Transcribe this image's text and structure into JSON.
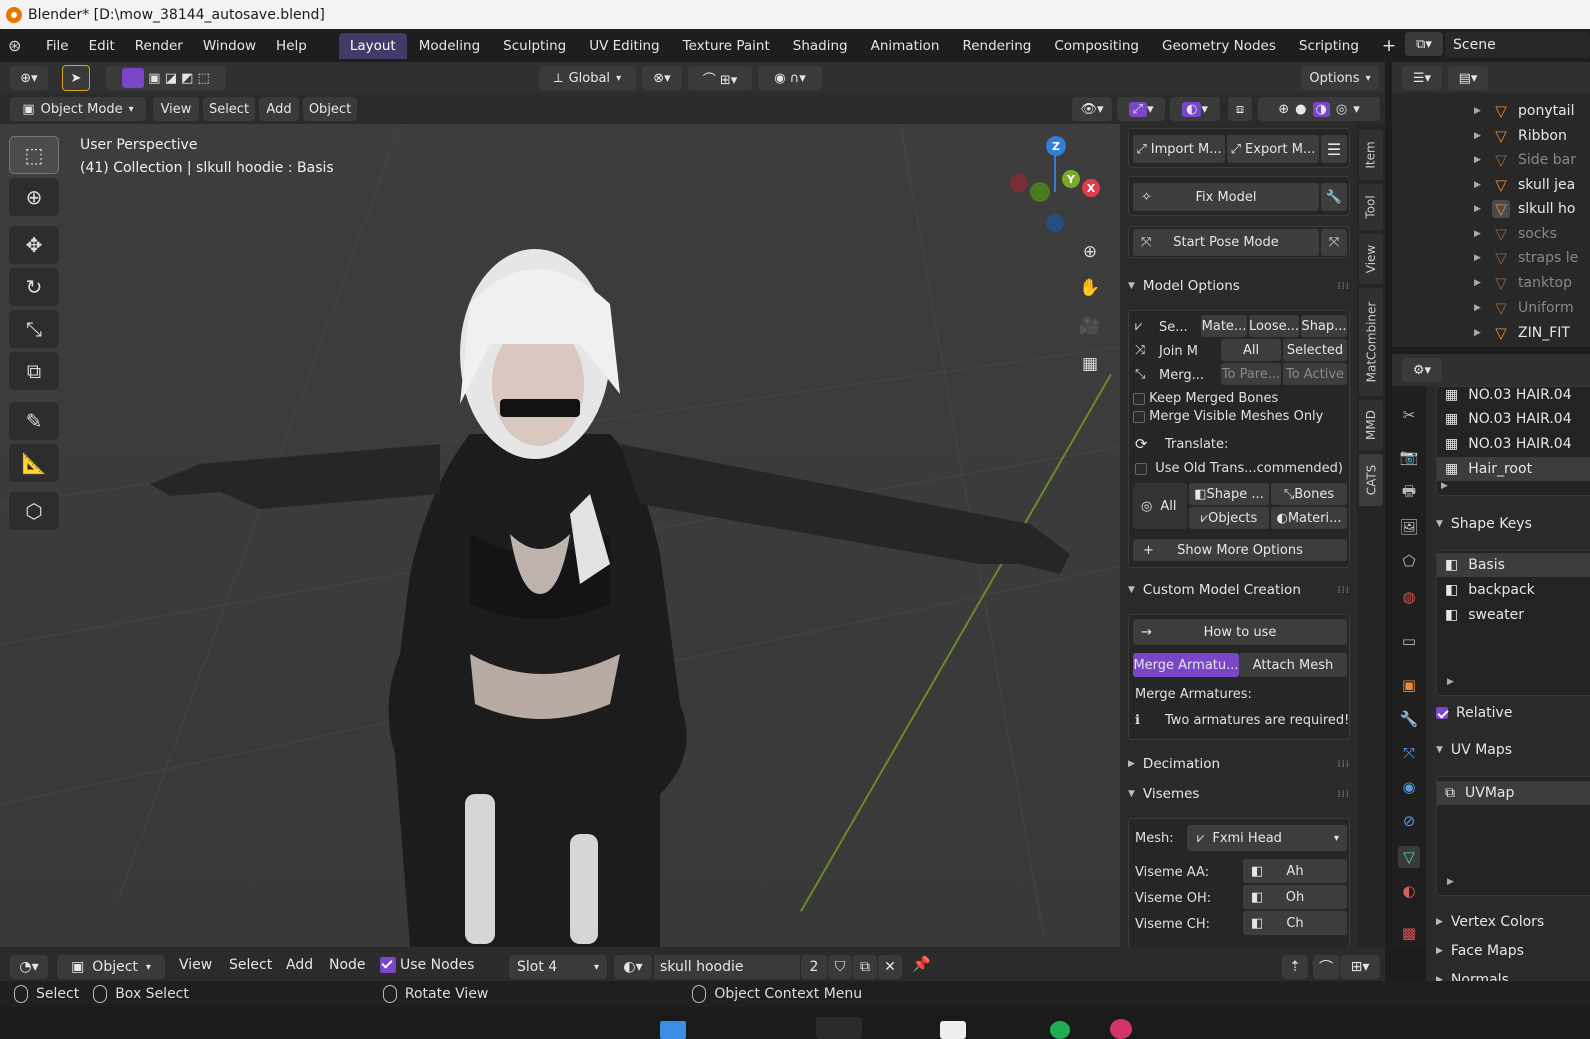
{
  "window": {
    "title": "Blender* [D:\\mow_38144_autosave.blend]"
  },
  "menu": [
    "File",
    "Edit",
    "Render",
    "Window",
    "Help"
  ],
  "workspaces": [
    "Layout",
    "Modeling",
    "Sculpting",
    "UV Editing",
    "Texture Paint",
    "Shading",
    "Animation",
    "Rendering",
    "Compositing",
    "Geometry Nodes",
    "Scripting"
  ],
  "add_workspace": "+",
  "scene": {
    "name": "Scene"
  },
  "header": {
    "orientation": "Global",
    "options": "Options"
  },
  "header2": {
    "mode": "Object Mode",
    "menu": [
      "View",
      "Select",
      "Add",
      "Object"
    ]
  },
  "viewport": {
    "perspective": "User Perspective",
    "collection_info": "(41) Collection | slkull hoodie : Basis",
    "axes": {
      "z": "Z",
      "y": "Y",
      "x": "X"
    }
  },
  "npanel": {
    "import": "Import M...",
    "export": "Export M...",
    "fix_model": "Fix Model",
    "start_pose": "Start Pose Mode",
    "model_options": {
      "title": "Model Options",
      "separate": "Se...",
      "sep_opts": [
        "Mate...",
        "Loose...",
        "Shap..."
      ],
      "join": "Join M",
      "join_opts": [
        "All",
        "Selected"
      ],
      "merge": "Merg...",
      "merge_opts": [
        "To Pare...",
        "To Active"
      ],
      "keep_merged": "Keep Merged Bones",
      "merge_visible": "Merge Visible Meshes Only",
      "translate": "Translate:",
      "use_old": "Use Old Trans...commended)",
      "all": "All",
      "tr_opts": [
        "Shape ...",
        "Bones",
        "Objects",
        "Materi..."
      ],
      "show_more": "Show More Options"
    },
    "custom_model": {
      "title": "Custom Model Creation",
      "how_to": "How to use",
      "tabs": [
        "Merge Armatu...",
        "Attach Mesh"
      ],
      "merge_label": "Merge Armatures:",
      "warning": "Two armatures are required!"
    },
    "decimation": "Decimation",
    "visemes": {
      "title": "Visemes",
      "mesh_label": "Mesh:",
      "mesh_value": "Fxmi Head",
      "rows": [
        {
          "label": "Viseme AA:",
          "value": "Ah"
        },
        {
          "label": "Viseme OH:",
          "value": "Oh"
        },
        {
          "label": "Viseme CH:",
          "value": "Ch"
        }
      ]
    }
  },
  "vtabs": [
    "Item",
    "Tool",
    "View",
    "MatCombiner",
    "MMD",
    "CATS"
  ],
  "outliner": {
    "items": [
      {
        "name": "ponytail",
        "dim": false
      },
      {
        "name": "Ribbon",
        "dim": false
      },
      {
        "name": "Side bar",
        "dim": true
      },
      {
        "name": "skull jea",
        "dim": false
      },
      {
        "name": "slkull ho",
        "dim": false
      },
      {
        "name": "socks",
        "dim": true
      },
      {
        "name": "straps le",
        "dim": true
      },
      {
        "name": "tanktop",
        "dim": true
      },
      {
        "name": "Uniform",
        "dim": true
      },
      {
        "name": "ZIN_FIT",
        "dim": false
      }
    ]
  },
  "properties": {
    "vgroups": [
      "NO.03 HAIR.04",
      "NO.03 HAIR.04",
      "NO.03 HAIR.04",
      "Hair_root"
    ],
    "shape_keys_title": "Shape Keys",
    "shape_keys": [
      "Basis",
      "backpack",
      "sweater"
    ],
    "relative": "Relative",
    "uv_maps_title": "UV Maps",
    "uv_maps": [
      "UVMap"
    ],
    "vertex_colors": "Vertex Colors",
    "face_maps": "Face Maps",
    "normals": "Normals"
  },
  "bottom": {
    "editor": "Object",
    "menu": [
      "View",
      "Select",
      "Add",
      "Node"
    ],
    "use_nodes": "Use Nodes",
    "slot": "Slot 4",
    "material": "skull hoodie",
    "users": "2"
  },
  "status": {
    "select": "Select",
    "box_select": "Box Select",
    "rotate": "Rotate View",
    "context": "Object Context Menu"
  },
  "colors": {
    "accent": "#7a46c8",
    "workspace_active": "#443a6a",
    "bg": "#1d1d1d"
  }
}
